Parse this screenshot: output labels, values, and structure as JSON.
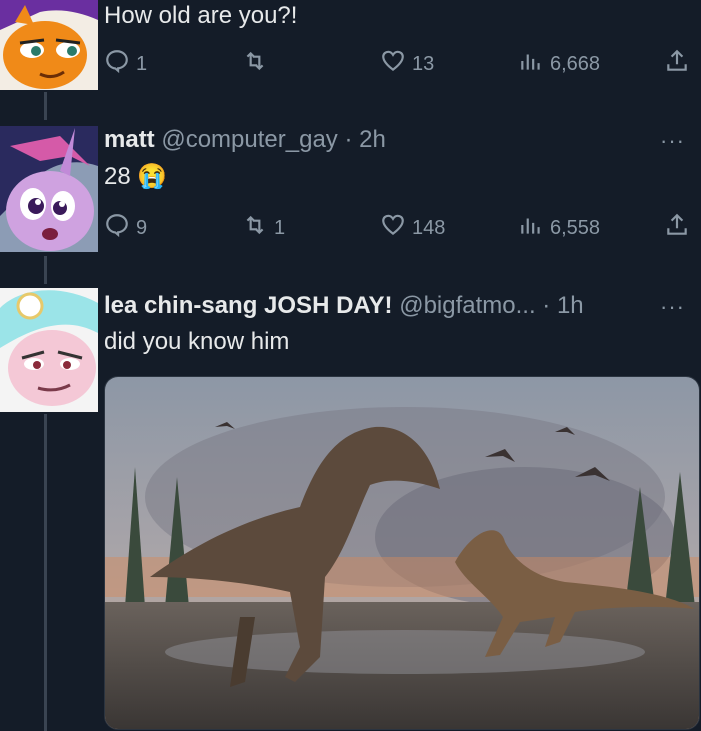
{
  "tweets": [
    {
      "text": "How old are you?!",
      "replies": "1",
      "retweets": "",
      "likes": "13",
      "views": "6,668"
    },
    {
      "name": "matt",
      "handle": "@computer_gay",
      "time": "· 2h",
      "text": "28",
      "emoji": "😭",
      "replies": "9",
      "retweets": "1",
      "likes": "148",
      "views": "6,558",
      "more": "···"
    },
    {
      "name": "lea chin-sang JOSH DAY!",
      "handle": "@bigfatmo...",
      "time": "· 1h",
      "text": "did you know him",
      "more": "···"
    }
  ],
  "icons": {
    "reply": "reply-icon",
    "retweet": "retweet-icon",
    "like": "heart-icon",
    "views": "views-icon",
    "share": "share-icon"
  },
  "colors": {
    "background": "#141c28",
    "muted": "#8b98a5",
    "text": "#e7e9ea"
  }
}
